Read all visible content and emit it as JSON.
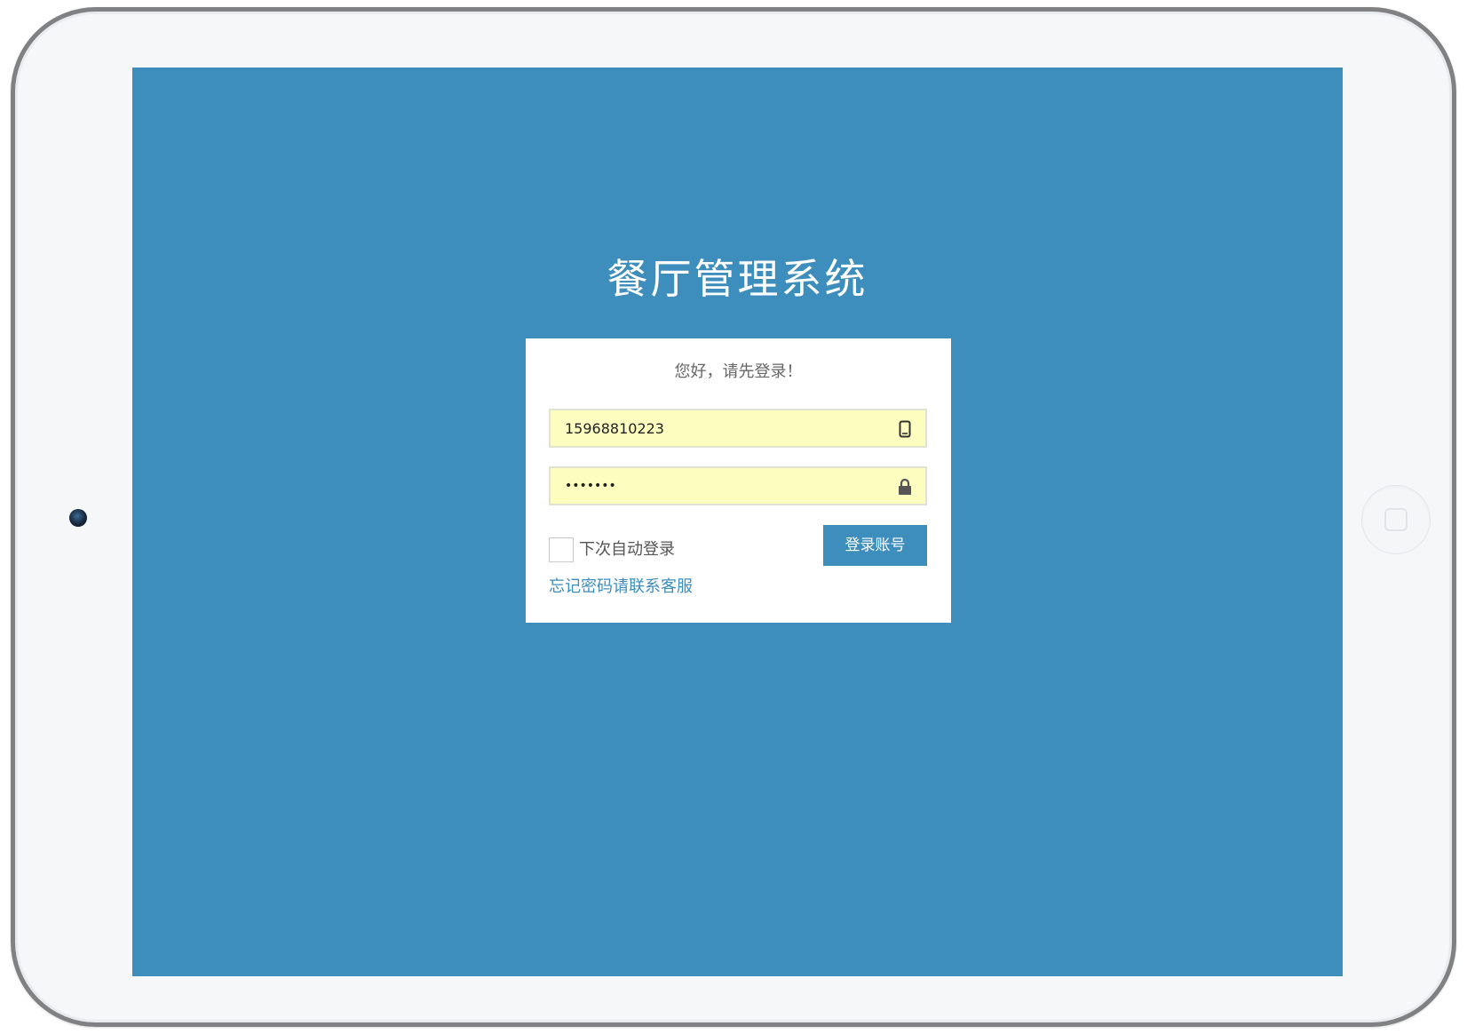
{
  "app": {
    "title": "餐厅管理系统"
  },
  "login": {
    "greeting": "您好，请先登录！",
    "phone": {
      "value": "15968810223",
      "icon": "mobile-phone-icon"
    },
    "password": {
      "value": "1234567",
      "icon": "lock-icon"
    },
    "remember_label": "下次自动登录",
    "remember_checked": false,
    "submit_label": "登录账号",
    "forgot_label": "忘记密码请联系客服"
  },
  "colors": {
    "screen_background": "#3d8ebd",
    "button": "#3d8ebd",
    "link": "#3d8ebd",
    "autofill_field": "#fcfdbf",
    "card": "#ffffff"
  }
}
